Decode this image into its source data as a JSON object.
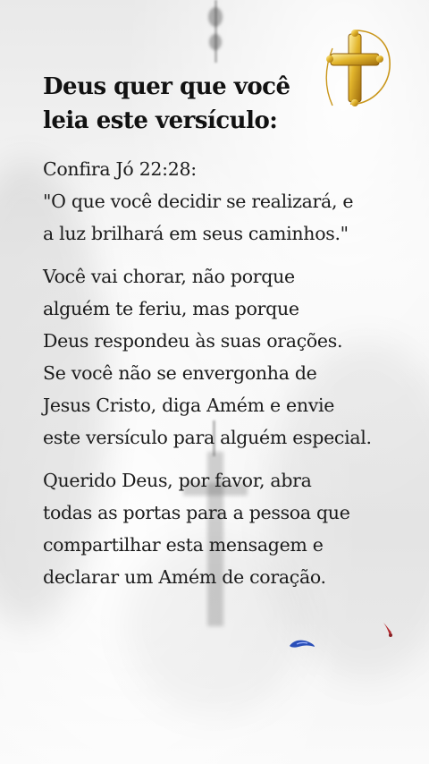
{
  "title": "Deus quer que você\nleia este versículo:",
  "paragraphs": [
    "Confira Jó 22:28:\n\"O que você decidir se realizará, e\na luz brilhará em seus caminhos.\"",
    "Você vai chorar, não porque\nalguém te feriu, mas porque\nDeus respondeu às suas orações.\nSe você não se envergonha de\nJesus Cristo, diga Amém e envie\neste versículo para alguém especial.",
    "Querido Deus, por favor, abra\ntodas as portas para a pessoa que\ncompartilhar esta mensagem e\ndeclarar um Amém de coração."
  ],
  "icons": [
    "golden-cross-icon",
    "blue-mark-icon",
    "red-mark-icon"
  ],
  "colors": {
    "background": "#f3f3f3",
    "text": "#1a1a1a",
    "cross_gold": "#d4a017"
  }
}
